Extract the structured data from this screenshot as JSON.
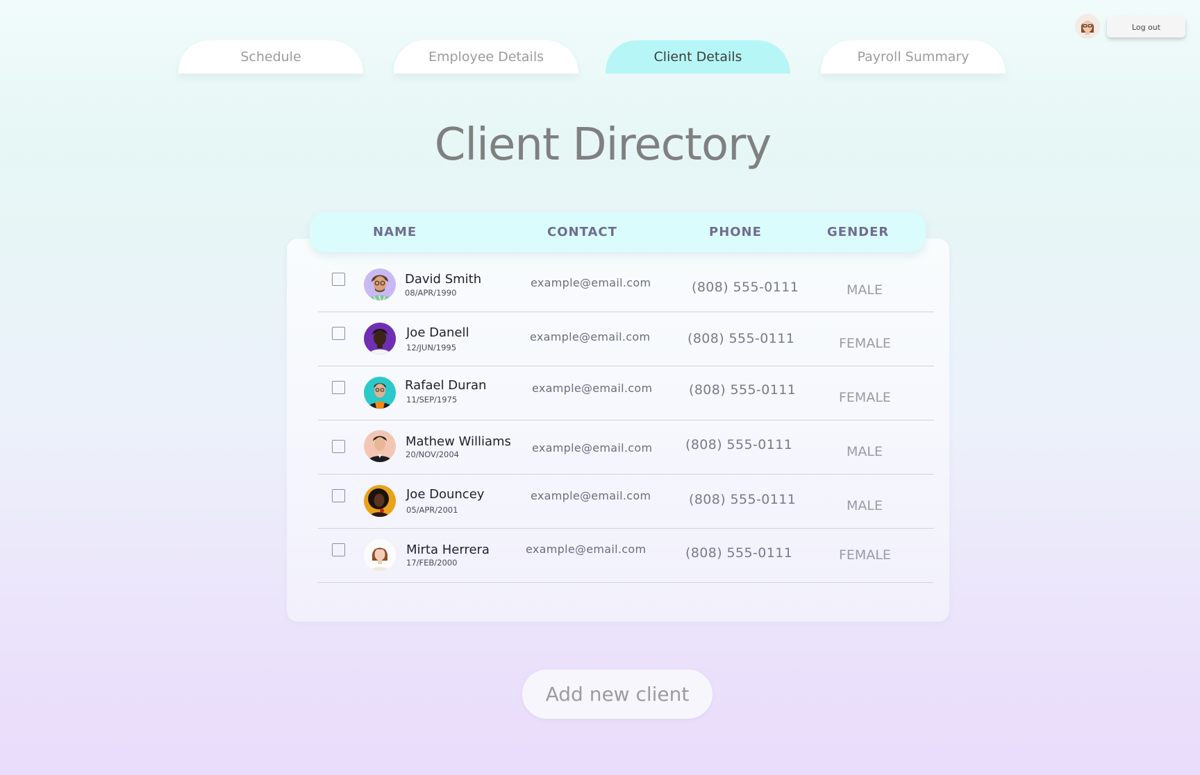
{
  "nav": {
    "tabs": [
      {
        "label": "Schedule",
        "active": false
      },
      {
        "label": "Employee Details",
        "active": false
      },
      {
        "label": "Client Details",
        "active": true
      },
      {
        "label": "Payroll Summary",
        "active": false
      }
    ]
  },
  "user": {
    "logout_label": "Log out"
  },
  "page": {
    "title": "Client Directory"
  },
  "table": {
    "headers": [
      "NAME",
      "CONTACT",
      "PHONE",
      "GENDER"
    ],
    "rows": [
      {
        "name": "David Smith",
        "dob": "08/APR/1990",
        "email": "example@email.com",
        "phone": "(808) 555-0111",
        "gender": "MALE",
        "avatar_color": "#c9b9f3"
      },
      {
        "name": "Joe Danell",
        "dob": "12/JUN/1995",
        "email": "example@email.com",
        "phone": "(808) 555-0111",
        "gender": "FEMALE",
        "avatar_color": "#6f2fb3"
      },
      {
        "name": "Rafael Duran",
        "dob": "11/SEP/1975",
        "email": "example@email.com",
        "phone": "(808) 555-0111",
        "gender": "FEMALE",
        "avatar_color": "#2bc9c9"
      },
      {
        "name": "Mathew Williams",
        "dob": "20/NOV/2004",
        "email": "example@email.com",
        "phone": "(808) 555-0111",
        "gender": "MALE",
        "avatar_color": "#f3c6b4"
      },
      {
        "name": "Joe Douncey",
        "dob": "05/APR/2001",
        "email": "example@email.com",
        "phone": "(808) 555-0111",
        "gender": "MALE",
        "avatar_color": "#e9a21a"
      },
      {
        "name": "Mirta Herrera",
        "dob": "17/FEB/2000",
        "email": "example@email.com",
        "phone": "(808) 555-0111",
        "gender": "FEMALE",
        "avatar_color": "#fdfcfc"
      }
    ]
  },
  "actions": {
    "add_client_label": "Add new client"
  },
  "colors": {
    "active_tab": "#b7f6f6",
    "table_header": "#dbfcfc",
    "header_text": "#6f6d8f"
  }
}
